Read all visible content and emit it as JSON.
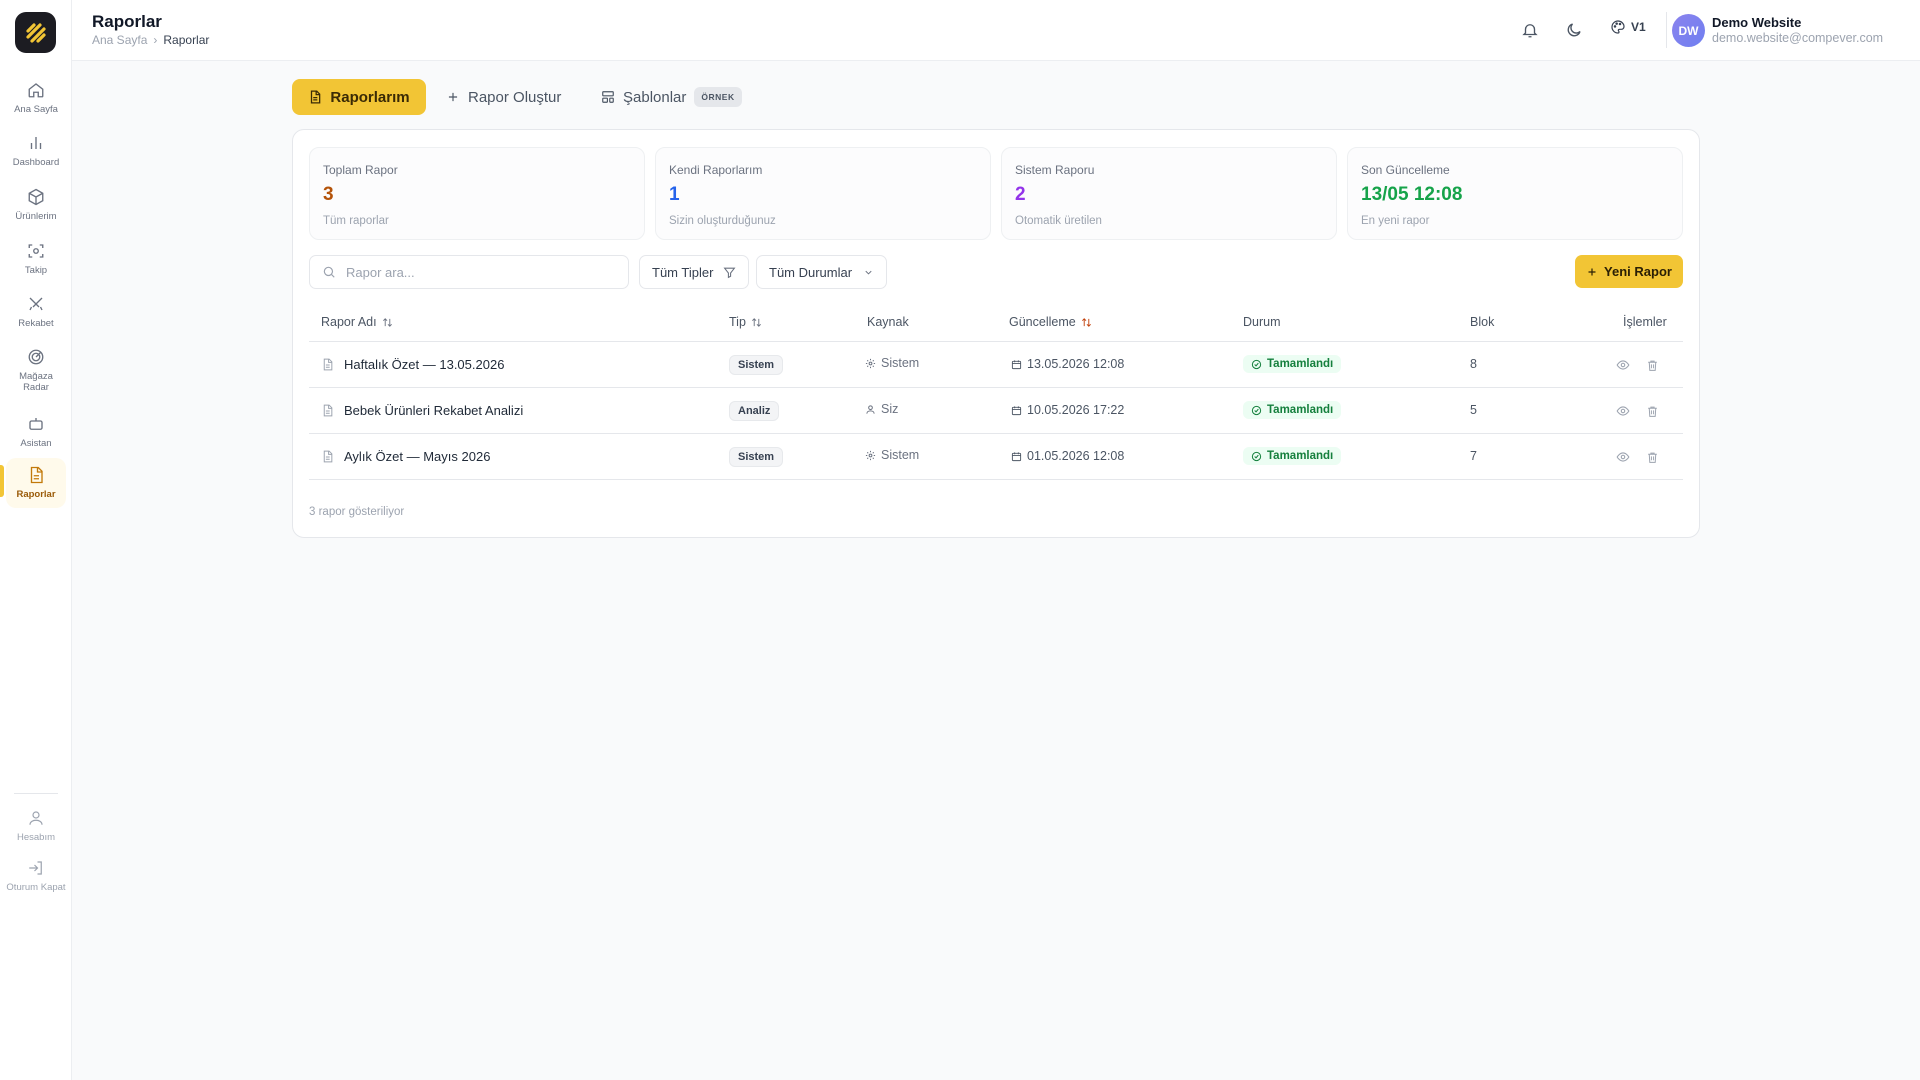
{
  "header": {
    "title": "Raporlar",
    "breadcrumb": [
      "Ana Sayfa",
      "Raporlar"
    ],
    "theme_label": "V1",
    "user": {
      "initials": "DW",
      "name": "Demo Website",
      "email": "demo.website@compever.com"
    }
  },
  "sidebar": {
    "items": [
      {
        "label": "Ana Sayfa",
        "icon": "home-icon"
      },
      {
        "label": "Dashboard",
        "icon": "chart-icon"
      },
      {
        "label": "Ürünlerim",
        "icon": "box-icon"
      },
      {
        "label": "Takip",
        "icon": "scan-icon"
      },
      {
        "label": "Rekabet",
        "icon": "swords-icon"
      },
      {
        "label": "Mağaza Radar",
        "icon": "radar-icon"
      },
      {
        "label": "Asistan",
        "icon": "bot-icon"
      },
      {
        "label": "Raporlar",
        "icon": "file-icon",
        "active": true
      }
    ],
    "bottom": [
      {
        "label": "Hesabım",
        "icon": "user-icon"
      },
      {
        "label": "Oturum Kapat",
        "icon": "logout-icon"
      }
    ]
  },
  "tabs": [
    {
      "label": "Raporlarım",
      "active": true
    },
    {
      "label": "Rapor Oluştur"
    },
    {
      "label": "Şablonlar",
      "badge": "ÖRNEK"
    }
  ],
  "stats": [
    {
      "title": "Toplam Rapor",
      "value": "3",
      "subtitle": "Tüm raporlar",
      "color": "#b45309"
    },
    {
      "title": "Kendi Raporlarım",
      "value": "1",
      "subtitle": "Sizin oluşturduğunuz",
      "color": "#2563eb"
    },
    {
      "title": "Sistem Raporu",
      "value": "2",
      "subtitle": "Otomatik üretilen",
      "color": "#9333ea"
    },
    {
      "title": "Son Güncelleme",
      "value": "13/05 12:08",
      "subtitle": "En yeni rapor",
      "color": "#16a34a"
    }
  ],
  "toolbar": {
    "search_placeholder": "Rapor ara...",
    "type_filter": "Tüm Tipler",
    "status_filter": "Tüm Durumlar",
    "new_button": "Yeni Rapor"
  },
  "table": {
    "columns": [
      "Rapor Adı",
      "Tip",
      "Kaynak",
      "Güncelleme",
      "Durum",
      "Blok",
      "İşlemler"
    ],
    "rows": [
      {
        "name": "Haftalık Özet — 13.05.2026",
        "type": "Sistem",
        "source": "Sistem",
        "date": "13.05.2026 12:08",
        "status": "Tamamlandı",
        "blocks": "8"
      },
      {
        "name": "Bebek Ürünleri Rekabet Analizi",
        "type": "Analiz",
        "source": "Siz",
        "date": "10.05.2026 17:22",
        "status": "Tamamlandı",
        "blocks": "5"
      },
      {
        "name": "Aylık Özet — Mayıs 2026",
        "type": "Sistem",
        "source": "Sistem",
        "date": "01.05.2026 12:08",
        "status": "Tamamlandı",
        "blocks": "7"
      }
    ],
    "footer": "3 rapor gösteriliyor"
  },
  "colors": {
    "accent": "#f2c535",
    "success": "#15803d"
  }
}
